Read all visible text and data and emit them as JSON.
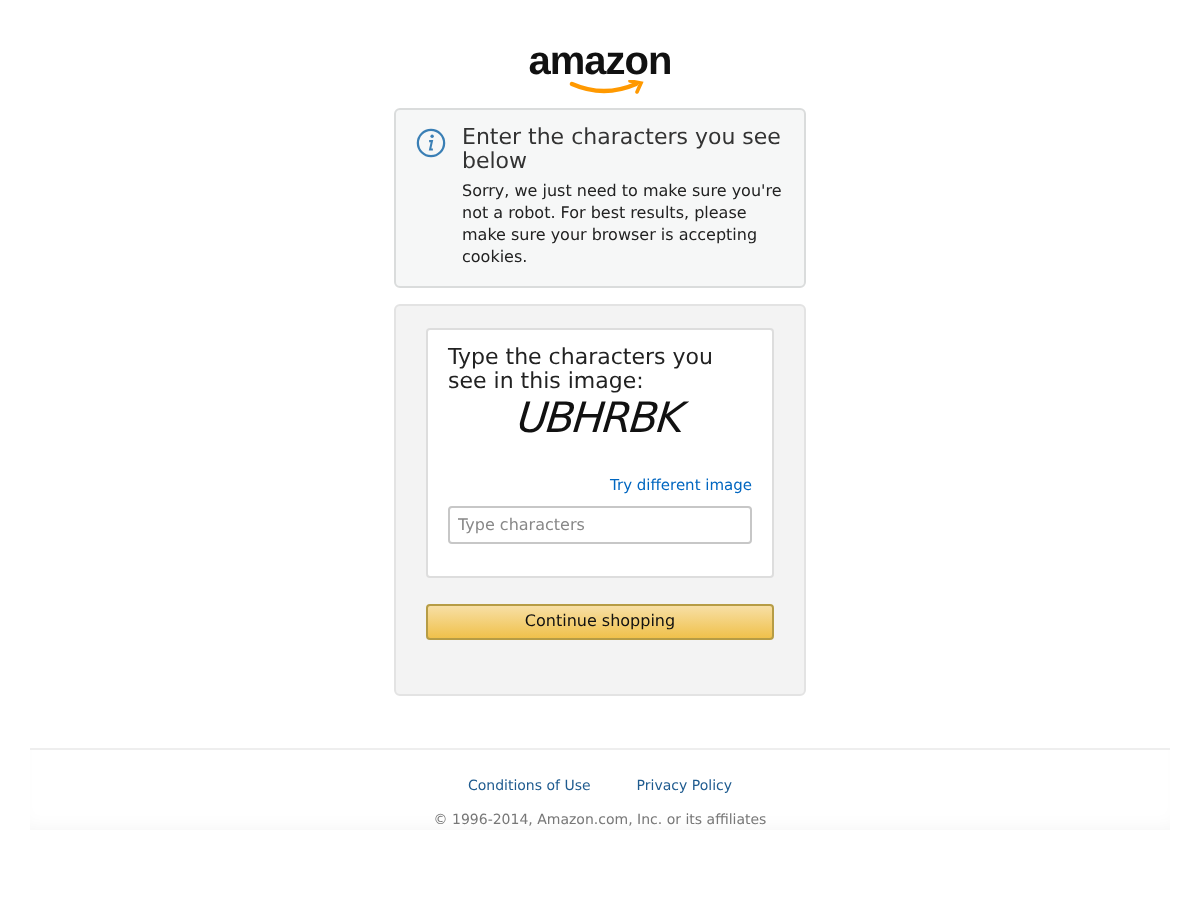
{
  "logo": {
    "text": "amazon"
  },
  "alert": {
    "title": "Enter the characters you see below",
    "message": "Sorry, we just need to make sure you're not a robot. For best results, please make sure your browser is accepting cookies."
  },
  "captcha": {
    "prompt": "Type the characters you see in this image:",
    "characters": "UBHRBK",
    "refresh_link": "Try different image",
    "input": {
      "placeholder": "Type characters"
    }
  },
  "submit_button": "Continue shopping",
  "footer": {
    "links": [
      "Conditions of Use",
      "Privacy Policy"
    ],
    "copyright": "© 1996-2014, Amazon.com, Inc. or its affiliates"
  }
}
